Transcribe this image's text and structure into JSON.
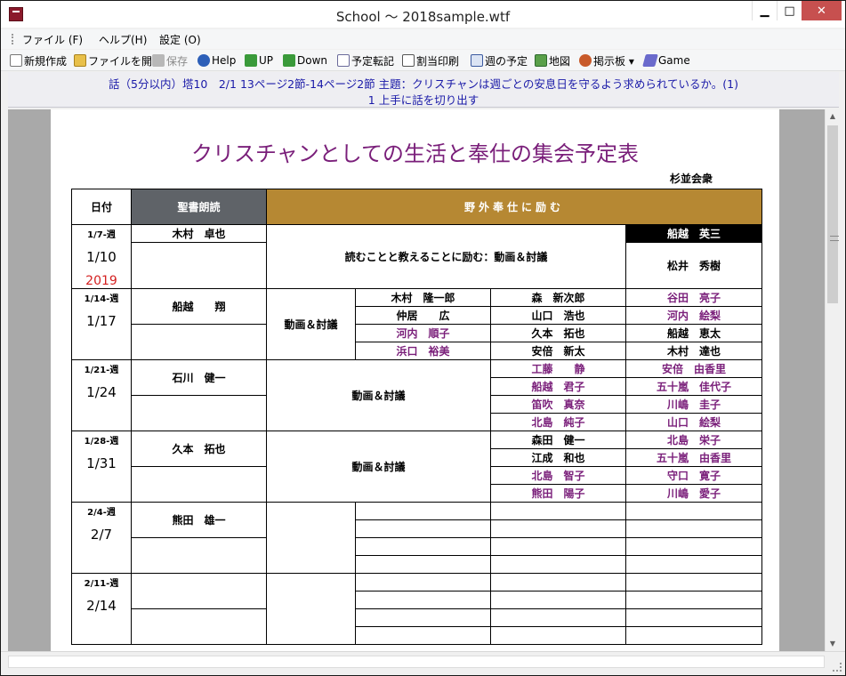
{
  "window": {
    "title": "School ～ 2018sample.wtf",
    "minimize_label": "▁",
    "maximize_label": "□",
    "close_label": "✕"
  },
  "menu": {
    "file": "ファイル (F)",
    "help": "ヘルプ(H)",
    "settings": "設定 (O)"
  },
  "toolbar": {
    "new": "新規作成",
    "open": "ファイルを開く",
    "save": "保存",
    "help": "Help",
    "up": "UP",
    "down": "Down",
    "schedule_transfer": "予定転記",
    "assignment_print": "割当印刷",
    "weekly_plan": "週の予定",
    "map": "地図",
    "bulletin": "掲示板 ▾",
    "game": "Game"
  },
  "topic": {
    "line1": "話（5分以内）塔10　2/1 13ページ2節-14ページ2節 主題：クリスチャンは週ごとの安息日を守るよう求められているか。(1)",
    "line2": "1 上手に話を切り出す"
  },
  "document": {
    "title": "クリスチャンとしての生活と奉仕の集会予定表",
    "congregation": "杉並会衆",
    "headers": {
      "date": "日付",
      "reading": "聖書朗読",
      "service": "野外奉仕に励む"
    },
    "weeks": [
      {
        "week": "1/7-週",
        "date": "1/10",
        "year": "2019",
        "reader": "木村　卓也",
        "theme": "読むことと教えることに励む：動画＆討議",
        "chair": "船越　英三",
        "chair2": "松井　秀樹"
      },
      {
        "week": "1/14-週",
        "date": "1/17",
        "reader": "船越　　翔",
        "theme": "動画＆討議",
        "col1": [
          "木村　隆一郎",
          "仲居　　広",
          "河内　順子",
          "浜口　裕美"
        ],
        "col2": [
          "森　新次郎",
          "山口　浩也",
          "久本　拓也",
          "安倍　新太"
        ],
        "col3": [
          "谷田　亮子",
          "河内　絵梨",
          "船越　恵太",
          "木村　達也"
        ]
      },
      {
        "week": "1/21-週",
        "date": "1/24",
        "reader": "石川　健一",
        "theme": "動画＆討議",
        "col2": [
          "工藤　　静",
          "船越　君子",
          "笛吹　真奈",
          "北島　純子"
        ],
        "col3": [
          "安倍　由香里",
          "五十嵐　佳代子",
          "川嶋　圭子",
          "山口　絵梨"
        ]
      },
      {
        "week": "1/28-週",
        "date": "1/31",
        "reader": "久本　拓也",
        "theme": "動画＆討議",
        "col2": [
          "森田　健一",
          "江成　和也",
          "北島　智子",
          "熊田　陽子"
        ],
        "col3": [
          "北島　栄子",
          "五十嵐　由香里",
          "守口　寛子",
          "川嶋　愛子"
        ]
      },
      {
        "week": "2/4-週",
        "date": "2/7",
        "reader": "熊田　雄一"
      },
      {
        "week": "2/11-週",
        "date": "2/14",
        "reader": ""
      }
    ]
  },
  "colors": {
    "title_purple": "#7a1f7a",
    "header_gray": "#5f6368",
    "header_gold": "#b68833",
    "topic_blue": "#1a1aa8",
    "year_red": "#d42020"
  }
}
